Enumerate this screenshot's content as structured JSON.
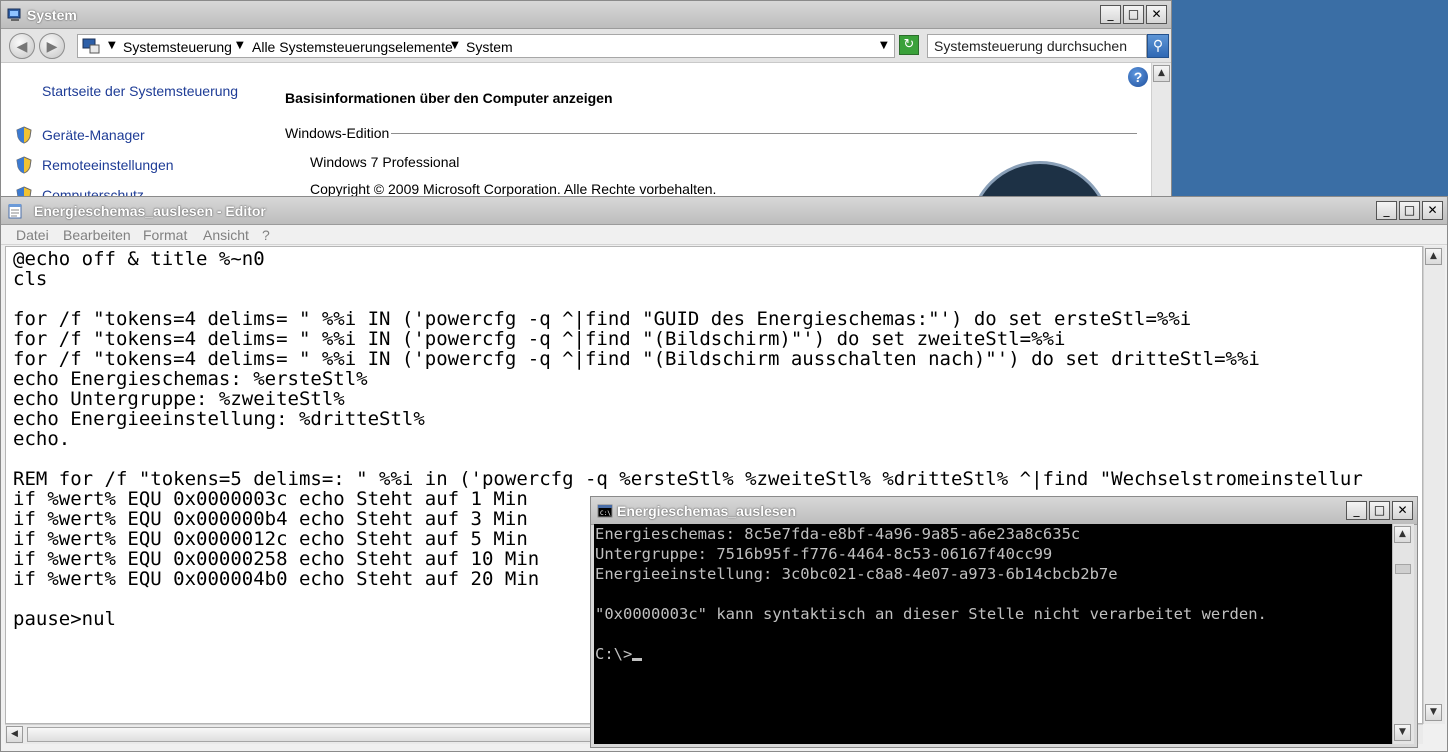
{
  "system_window": {
    "title": "System",
    "buttons": {
      "minimize": "_",
      "maximize": "□",
      "close": "✕"
    },
    "breadcrumb": [
      "Systemsteuerung",
      "Alle Systemsteuerungselemente",
      "System"
    ],
    "search_placeholder": "Systemsteuerung durchsuchen",
    "sidebar": {
      "home_link": "Startseite der Systemsteuerung",
      "links": [
        "Geräte-Manager",
        "Remoteeinstellungen",
        "Computerschutz"
      ]
    },
    "main": {
      "heading": "Basisinformationen über den Computer anzeigen",
      "section_label": "Windows-Edition",
      "edition": "Windows 7 Professional",
      "copyright": "Copyright © 2009 Microsoft Corporation. Alle Rechte vorbehalten."
    },
    "help_label": "?"
  },
  "editor_window": {
    "title": "Energieschemas_auslesen - Editor",
    "buttons": {
      "minimize": "_",
      "maximize": "□",
      "close": "✕"
    },
    "menu": [
      "Datei",
      "Bearbeiten",
      "Format",
      "Ansicht",
      "?"
    ],
    "lines": [
      "@echo off & title %~n0",
      "cls",
      "",
      "for /f \"tokens=4 delims= \" %%i IN ('powercfg -q ^|find \"GUID des Energieschemas:\"') do set ersteStl=%%i",
      "for /f \"tokens=4 delims= \" %%i IN ('powercfg -q ^|find \"(Bildschirm)\"') do set zweiteStl=%%i",
      "for /f \"tokens=4 delims= \" %%i IN ('powercfg -q ^|find \"(Bildschirm ausschalten nach)\"') do set dritteStl=%%i",
      "echo Energieschemas: %ersteStl%",
      "echo Untergruppe: %zweiteStl%",
      "echo Energieeinstellung: %dritteStl%",
      "echo.",
      "",
      "REM for /f \"tokens=5 delims=: \" %%i in ('powercfg -q %ersteStl% %zweiteStl% %dritteStl% ^|find \"Wechselstromeinstellur",
      "if %wert% EQU 0x0000003c echo Steht auf 1 Min",
      "if %wert% EQU 0x000000b4 echo Steht auf 3 Min",
      "if %wert% EQU 0x0000012c echo Steht auf 5 Min",
      "if %wert% EQU 0x00000258 echo Steht auf 10 Min",
      "if %wert% EQU 0x000004b0 echo Steht auf 20 Min",
      "",
      "pause>nul"
    ]
  },
  "cmd_window": {
    "title": "Energieschemas_auslesen",
    "buttons": {
      "minimize": "_",
      "maximize": "□",
      "close": "✕"
    },
    "lines": [
      "Energieschemas: 8c5e7fda-e8bf-4a96-9a85-a6e23a8c635c",
      "Untergruppe: 7516b95f-f776-4464-8c53-06167f40cc99",
      "Energieeinstellung: 3c0bc021-c8a8-4e07-a973-6b14cbcb2b7e",
      "",
      "\"0x0000003c\" kann syntaktisch an dieser Stelle nicht verarbeitet werden.",
      "",
      "C:\\>"
    ]
  }
}
